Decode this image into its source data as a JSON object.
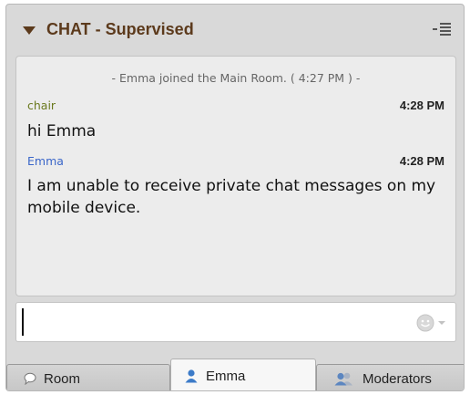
{
  "header": {
    "title": "CHAT - Supervised"
  },
  "chat": {
    "system_message": "- Emma joined the Main Room. ( 4:27 PM ) -",
    "messages": [
      {
        "sender": "chair",
        "time": "4:28 PM",
        "text": "hi Emma",
        "sender_color": "#6b7a1f"
      },
      {
        "sender": "Emma",
        "time": "4:28 PM",
        "text": "I am unable to receive private chat messages on my mobile device.",
        "sender_color": "#3a66c9"
      }
    ]
  },
  "input": {
    "value": "",
    "placeholder": ""
  },
  "tabs": [
    {
      "label": "Room",
      "icon": "speech-bubble-icon",
      "active": false
    },
    {
      "label": "Emma",
      "icon": "user-icon",
      "active": true
    },
    {
      "label": "Moderators",
      "icon": "users-icon",
      "active": false
    }
  ]
}
